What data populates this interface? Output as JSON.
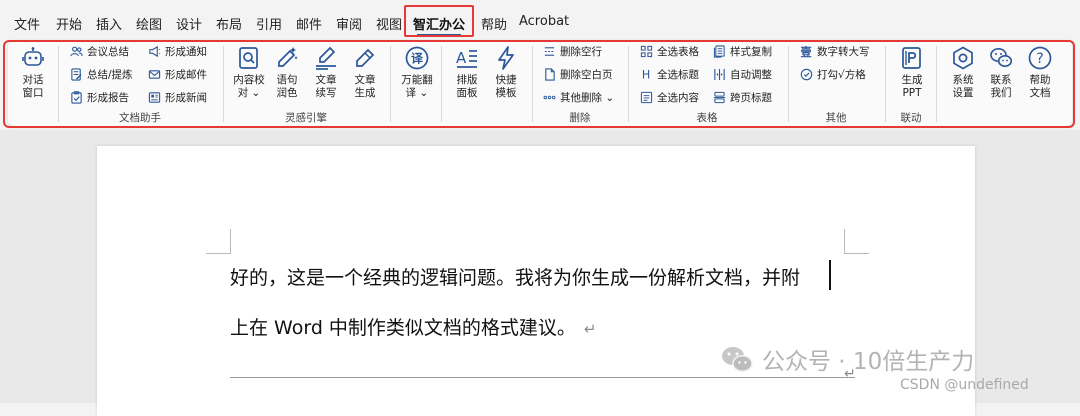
{
  "menu": {
    "items": [
      "文件",
      "开始",
      "插入",
      "绘图",
      "设计",
      "布局",
      "引用",
      "邮件",
      "审阅",
      "视图",
      "智汇办公",
      "帮助",
      "Acrobat"
    ],
    "active_tab": "智汇办公"
  },
  "ribbon": {
    "dialog_window": "对话\n窗口",
    "doc_assistant": {
      "label": "文档助手",
      "meeting_summary": "会议总结",
      "summary_extract": "总结/提炼",
      "gen_report": "形成报告",
      "gen_notice": "形成通知",
      "gen_email": "形成邮件",
      "gen_news": "形成新闻"
    },
    "inspiration": {
      "label": "灵感引擎",
      "content_proofread": "内容校\n对",
      "sentence_polish": "语句\n润色",
      "article_continue": "文章\n续写",
      "article_generate": "文章\n生成"
    },
    "translate": {
      "all_translate": "万能翻\n译"
    },
    "layout": {
      "layout_panel": "排版\n面板",
      "quick_template": "快捷\n模板"
    },
    "delete": {
      "label": "删除",
      "delete_empty_rows": "删除空行",
      "delete_blank_pages": "删除空白页",
      "other_delete": "其他删除"
    },
    "table": {
      "label": "表格",
      "select_all_tables": "全选表格",
      "select_all_titles": "全选标题",
      "select_all_content": "全选内容",
      "copy_style": "样式复制",
      "auto_adjust": "自动调整",
      "cross_page_title": "跨页标题"
    },
    "other": {
      "label": "其他",
      "num_to_upper": "数字转大写",
      "check_box": "打勾√方格"
    },
    "link": {
      "label": "联动",
      "gen_ppt": "生成\nPPT"
    },
    "settings": {
      "system_settings": "系统\n设置",
      "contact_us": "联系\n我们",
      "help_doc": "帮助\n文档"
    }
  },
  "document": {
    "line1": "好的，这是一个经典的逻辑问题。我将为你生成一份解析文档，并附",
    "line2": "上在 Word 中制作类似文档的格式建议。",
    "para_mark": "↵"
  },
  "watermark": {
    "main": "公众号 · 10倍生产力",
    "csdn": "CSDN @undefined"
  },
  "colors": {
    "icon_blue": "#2b579a",
    "highlight_red": "#e53935",
    "ribbon_bg": "#fafafa",
    "app_bg": "#f3f3f3"
  }
}
